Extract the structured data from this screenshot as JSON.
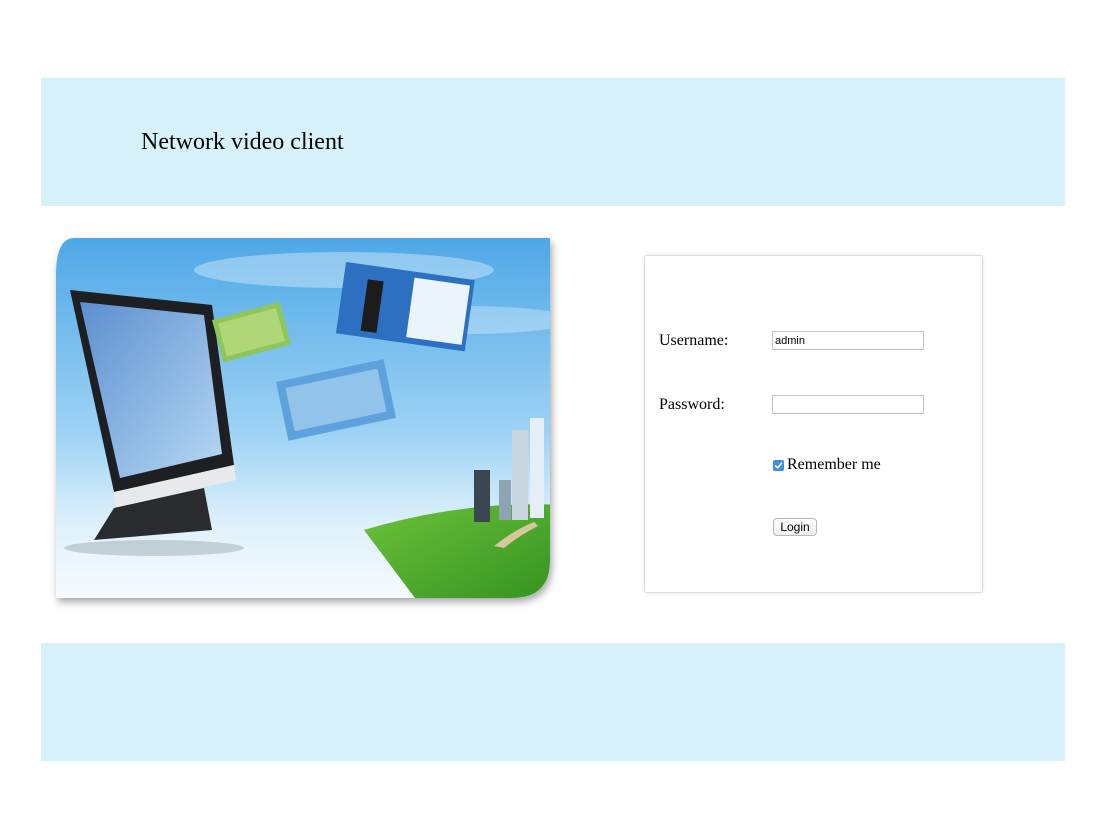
{
  "header": {
    "title": "Network video client"
  },
  "login": {
    "username_label": "Username:",
    "username_value": "admin",
    "password_label": "Password:",
    "password_value": "",
    "remember_label": "Remember me",
    "remember_checked": true,
    "login_button": "Login"
  },
  "colors": {
    "band": "#d7f1fb",
    "checkbox_accent": "#3d8ee6"
  }
}
